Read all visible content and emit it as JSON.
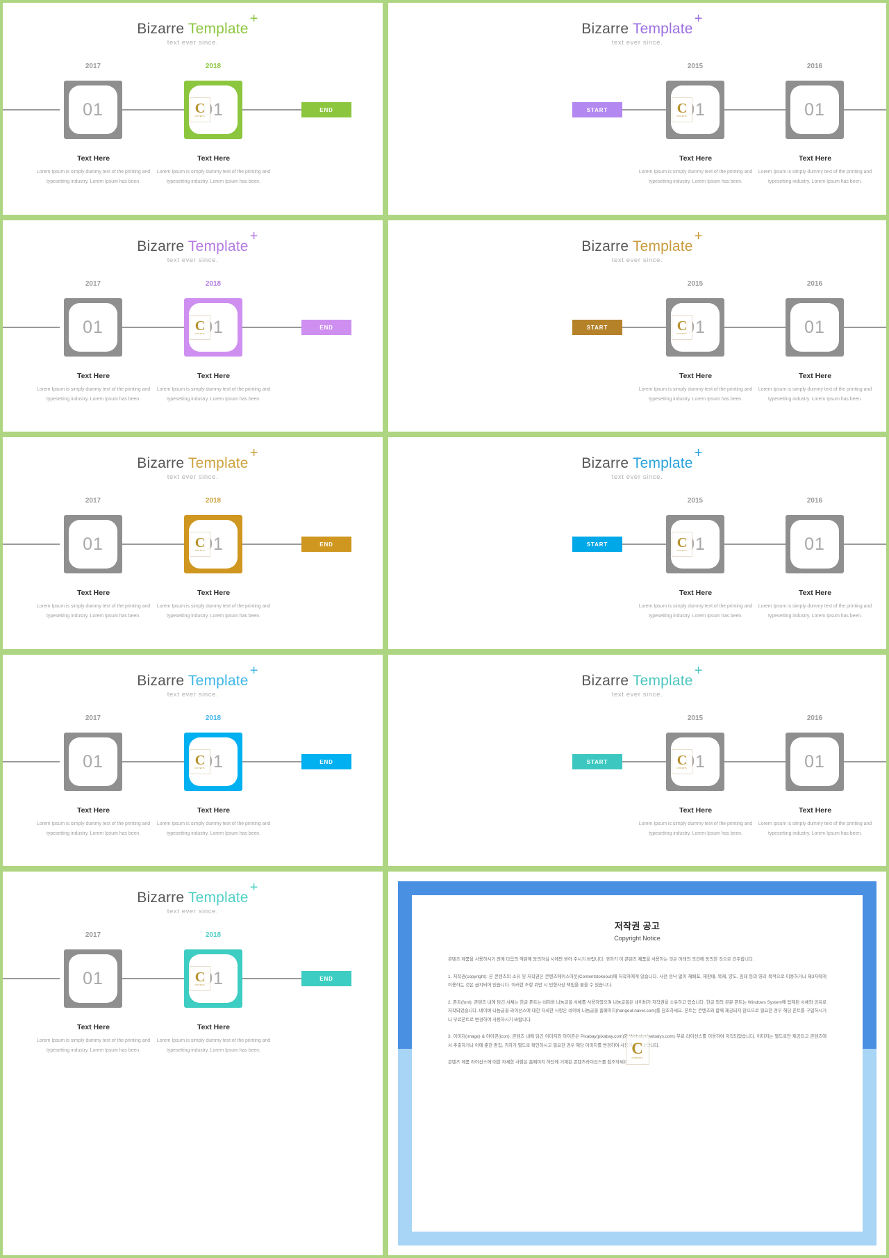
{
  "common": {
    "title_part1": "Bizarre ",
    "title_part2": "Template",
    "plus_icon": "+",
    "subtitle": "text ever since.",
    "node_number": "01",
    "caption_title": "Text Here",
    "caption_body": "Lorem Ipsum is simply dummy text of the printing and typesetting industry. Lorem Ipsum has been.",
    "watermark_letter": "C",
    "watermark_text": "CONTENTS",
    "gray_color": "#8f8f8f",
    "rail_color": "#9a9a9a",
    "frame_border_color": "#aed581"
  },
  "panels": [
    {
      "id": "panel-green-end",
      "accent": "#8cc63f",
      "accent_text": "#8cc63f",
      "layout": "end",
      "pill_label": "END",
      "years": [
        "2017",
        "2018"
      ],
      "active_index": 1
    },
    {
      "id": "panel-purple-start",
      "accent": "#b388f0",
      "accent_text": "#9b6fe0",
      "layout": "start",
      "pill_label": "START",
      "years": [
        "2015",
        "2016"
      ],
      "active_index": -1
    },
    {
      "id": "panel-violet-end",
      "accent": "#cf8ff0",
      "accent_text": "#b37ae0",
      "layout": "end",
      "pill_label": "END",
      "years": [
        "2017",
        "2018"
      ],
      "active_index": 1
    },
    {
      "id": "panel-brown-start",
      "accent": "#b5822a",
      "accent_text": "#c89a3c",
      "layout": "start",
      "pill_label": "START",
      "years": [
        "2015",
        "2016"
      ],
      "active_index": -1
    },
    {
      "id": "panel-gold-end",
      "accent": "#cf9620",
      "accent_text": "#cda23e",
      "layout": "end",
      "pill_label": "END",
      "years": [
        "2017",
        "2018"
      ],
      "active_index": 1
    },
    {
      "id": "panel-blue-start",
      "accent": "#00a8e8",
      "accent_text": "#29a3dc",
      "layout": "start",
      "pill_label": "START",
      "years": [
        "2015",
        "2016"
      ],
      "active_index": -1
    },
    {
      "id": "panel-skyblue-end",
      "accent": "#00b0f0",
      "accent_text": "#3fb6e8",
      "layout": "end",
      "pill_label": "END",
      "years": [
        "2017",
        "2018"
      ],
      "active_index": 1
    },
    {
      "id": "panel-teal-start",
      "accent": "#3cc8c0",
      "accent_text": "#4cc6c0",
      "layout": "start",
      "pill_label": "START",
      "years": [
        "2015",
        "2016"
      ],
      "active_index": -1
    },
    {
      "id": "panel-turquoise-end",
      "accent": "#3ecdc2",
      "accent_text": "#4fcfc4",
      "layout": "end",
      "pill_label": "END",
      "years": [
        "2017",
        "2018"
      ],
      "active_index": 1
    }
  ],
  "copyright": {
    "heading_ko": "저작권 공고",
    "heading_en": "Copyright Notice",
    "paragraphs": [
      "콘텐츠 제품을 사용하시기 전에 다음의 약관에 동의하실 시에만 받아 주시기 바랍니다. 귀하가 이 콘텐츠 제품을 사용하는 것은 아래의 조건에 동의한 것으로 간주합니다.",
      "1. 저작권(copyright): 본 콘텐츠의 소유 및 저작권은 콘텐츠에이스아웃(Contentstokeout)에 저작자에게 있습니다. 사전 승낙 없이 재배포, 재판매, 복제, 양도, 임대 등의 영리 목적으로 이용하거나 제3자에게 이용하는 것은 금지되어 있습니다. 이러한 조항 위반 시 민형사상 책임을 물을 수 있습니다.",
      "2. 폰트(font): 콘텐츠 내에 담긴 서체는 한글 폰트는 네이버 나눔글꼴 서체를 사용하였으며 나눔글꼴은 네이버가 저작권을 소유하고 있습니다. 한글 외의 본문 폰트는 Windows System에 탑재된 서체와 공유로 저작되었습니다. 네이버 나눔글꼴 라이선스에 대한 자세한 사항은 네이버 나눔글꼴 홈페이지(hangeul.naver.com)를 참조하세요. 폰트는 콘텐츠와 함께 제공되지 않으므로 필요한 경우 해당 폰트를 구입하시거나 무료폰트로 변경하여 사용하시기 바랍니다.",
      "3. 이미지(image) & 아이콘(icon): 콘텐츠 내에 담긴 이미지와 아이콘은 Pixabay(pixabay.com)와 Webalys(webalys.com) 무료 라이선스를 이용하여 저작되었습니다. 이미지는 별도로만 제공되고 콘텐츠에서 추출하거나 이에 준한 편집, 귀하가 별도로 확인하시고 필요한 경우 해당 이미지를 변경하여 사용하시기 바랍니다.",
      "콘텐츠 제품 라이선스에 대한 자세한 사항은 홈페이지 하단에 기재된 콘텐츠라이선스를 참조하세요."
    ]
  }
}
